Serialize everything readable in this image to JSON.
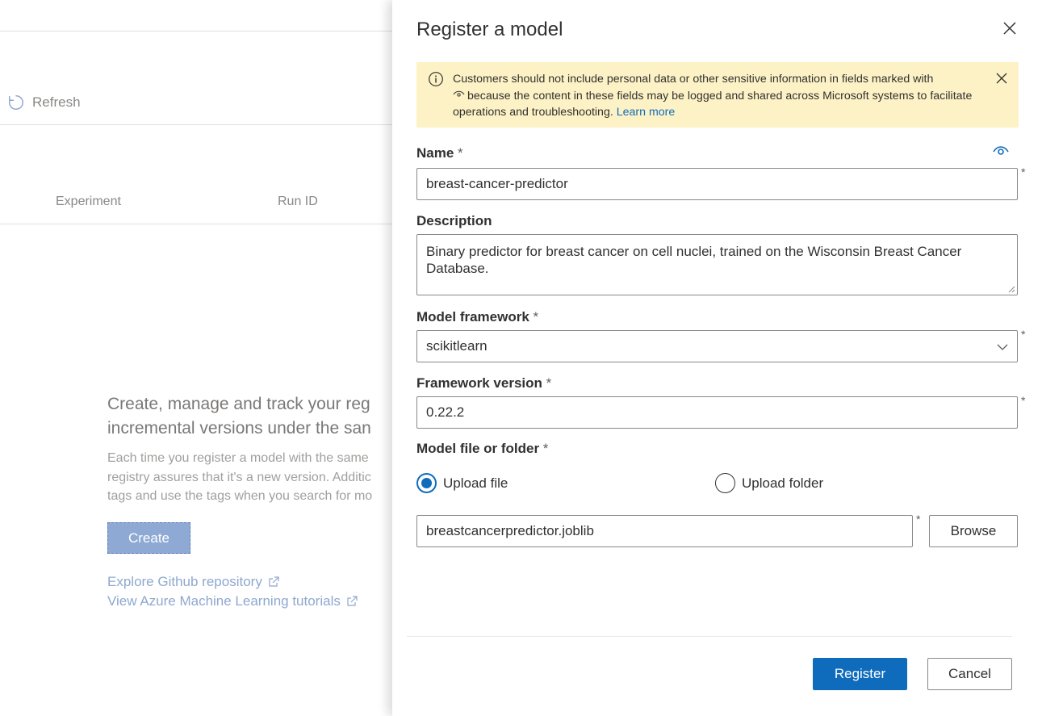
{
  "background": {
    "toolbar": {
      "refresh_label": "Refresh"
    },
    "table": {
      "columns": [
        "Experiment",
        "Run ID"
      ]
    },
    "empty_state": {
      "heading_line1": "Create, manage and track your reg",
      "heading_line2": "incremental versions under the san",
      "body_line1": "Each time you register a model with the same",
      "body_line2": "registry assures that it's a new version. Additic",
      "body_line3": "tags and use the tags when you search for mo",
      "create_label": "Create",
      "link_github": "Explore Github repository",
      "link_tutorials": "View Azure Machine Learning tutorials"
    }
  },
  "panel": {
    "title": "Register a model",
    "close_icon": "close-icon",
    "warning": {
      "text_part1": "Customers should not include personal data or other sensitive information in fields marked with",
      "text_part2": "because the content in these fields may be logged and shared across Microsoft systems to facilitate operations and troubleshooting.",
      "link": "Learn more"
    },
    "fields": {
      "name_label": "Name",
      "name_value": "breast-cancer-predictor",
      "description_label": "Description",
      "description_value": "Binary predictor for breast cancer on cell nuclei, trained on the Wisconsin Breast Cancer Database.",
      "framework_label": "Model framework",
      "framework_value": "scikitlearn",
      "version_label": "Framework version",
      "version_value": "0.22.2",
      "file_label": "Model file or folder",
      "radio_upload_file": "Upload file",
      "radio_upload_folder": "Upload folder",
      "file_value": "breastcancerpredictor.joblib",
      "browse_label": "Browse",
      "required_mark": "*"
    },
    "footer": {
      "register_label": "Register",
      "cancel_label": "Cancel"
    },
    "colors": {
      "accent": "#0f6cbd",
      "warning_bg": "#fdf2c5"
    }
  }
}
